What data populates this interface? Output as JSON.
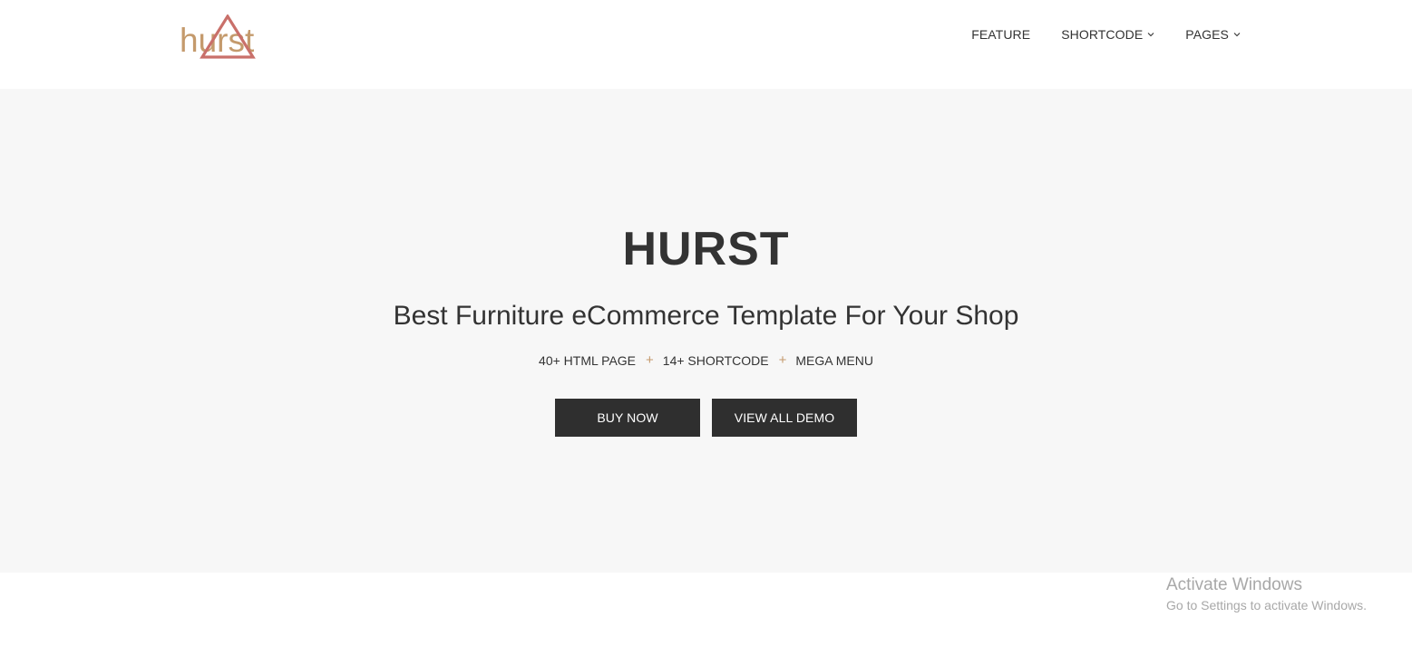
{
  "header": {
    "logo": {
      "text": "hurst",
      "text_color": "#c49a6c",
      "triangle_color": "#c9706a"
    },
    "nav": [
      {
        "label": "FEATURE",
        "has_dropdown": false,
        "icon": ""
      },
      {
        "label": "SHORTCODE",
        "has_dropdown": true,
        "icon": "chevron-down-icon"
      },
      {
        "label": "PAGES",
        "has_dropdown": true,
        "icon": "chevron-down-icon"
      }
    ]
  },
  "hero": {
    "background": "#f7f7f7",
    "title": "HURST",
    "subtitle": "Best Furniture eCommerce Template For Your Shop",
    "features": [
      "40+ HTML PAGE",
      "14+ SHORTCODE",
      "MEGA MENU"
    ],
    "separator": "+",
    "separator_color": "#c49a6c",
    "buttons": [
      {
        "label": "BUY NOW"
      },
      {
        "label": "VIEW ALL DEMO"
      }
    ],
    "button_color": "#2f2f2f"
  },
  "watermark": {
    "title": "Activate Windows",
    "subtitle": "Go to Settings to activate Windows."
  }
}
